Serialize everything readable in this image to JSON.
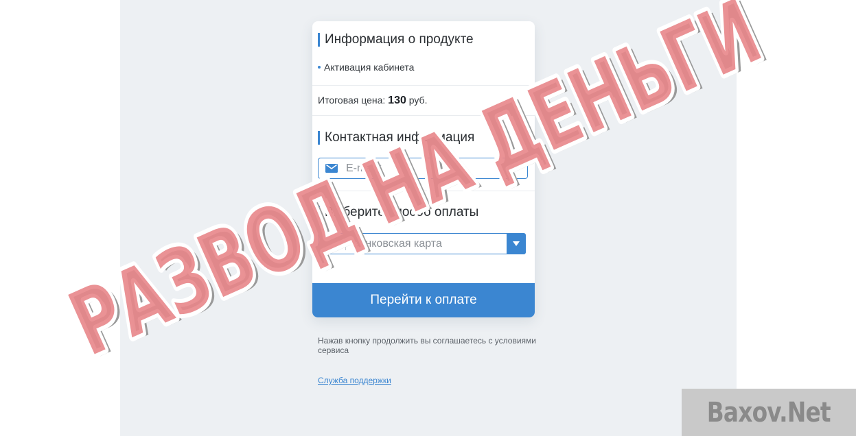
{
  "product": {
    "title": "Информация о продукте",
    "item": "Активация кабинета",
    "price_label": "Итоговая цена:",
    "price_value": "130",
    "price_currency": "руб."
  },
  "contact": {
    "title": "Контактная информация",
    "email_placeholder": "E-mail*",
    "email_icon": "envelope-icon"
  },
  "payment": {
    "title": "Выберите способ оплаты",
    "method_selected": "Банковская карта",
    "method_icon": "bank-card-icon",
    "submit_label": "Перейти к оплате"
  },
  "footer": {
    "terms_text": "Нажав кнопку продолжить вы соглашаетесь с условиями сервиса",
    "support_link": "Служба поддержки"
  },
  "overlay": {
    "stamp_text": "РАЗВОД НА ДЕНЬГИ",
    "site_watermark": "Baxov.Net"
  },
  "colors": {
    "accent": "#3b86d1",
    "page_bg": "#edf0f3",
    "stamp_red": "#e8868a",
    "stamp_shadow": "#9a9a9a"
  }
}
